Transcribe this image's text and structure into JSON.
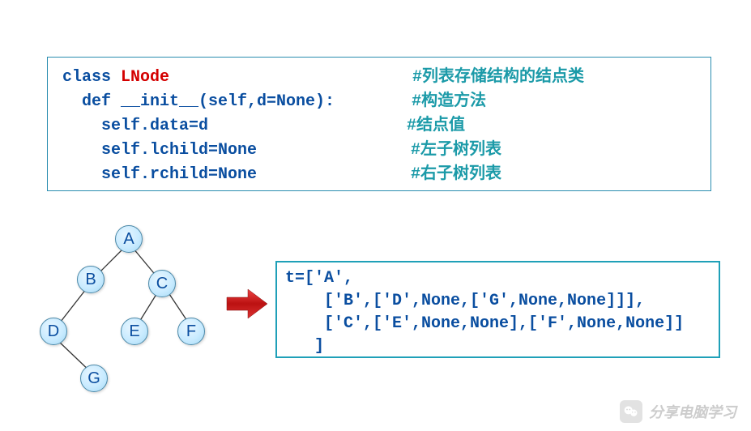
{
  "code": {
    "line1_kw": "class ",
    "line1_cls": "LNode",
    "line1_cmt": "#列表存储结构的结点类",
    "line2_def": "  def ",
    "line2_fn": "__init__",
    "line2_args": "(self,d=None):",
    "line2_cmt": "#构造方法",
    "line3_body": "    self.data=d",
    "line3_cmt": "#结点值",
    "line4_body": "    self.lchild=None",
    "line4_cmt": "#左子树列表",
    "line5_body": "    self.rchild=None",
    "line5_cmt": "#右子树列表"
  },
  "tree": {
    "nodes": {
      "A": "A",
      "B": "B",
      "C": "C",
      "D": "D",
      "E": "E",
      "F": "F",
      "G": "G"
    }
  },
  "tlist": {
    "l1": "t=['A',",
    "l2": "    ['B',['D',None,['G',None,None]]],",
    "l3": "    ['C',['E',None,None],['F',None,None]]",
    "l4": "   ]"
  },
  "watermark": {
    "text": "分享电脑学习"
  },
  "chart_data": {
    "type": "tree",
    "root": {
      "value": "A",
      "left": {
        "value": "B",
        "left": {
          "value": "D",
          "left": null,
          "right": {
            "value": "G",
            "left": null,
            "right": null
          }
        },
        "right": null
      },
      "right": {
        "value": "C",
        "left": {
          "value": "E",
          "left": null,
          "right": null
        },
        "right": {
          "value": "F",
          "left": null,
          "right": null
        }
      }
    },
    "list_repr": [
      "A",
      [
        "B",
        [
          "D",
          null,
          [
            "G",
            null,
            null
          ]
        ]
      ],
      [
        "C",
        [
          "E",
          null,
          null
        ],
        [
          "F",
          null,
          null
        ]
      ]
    ]
  }
}
